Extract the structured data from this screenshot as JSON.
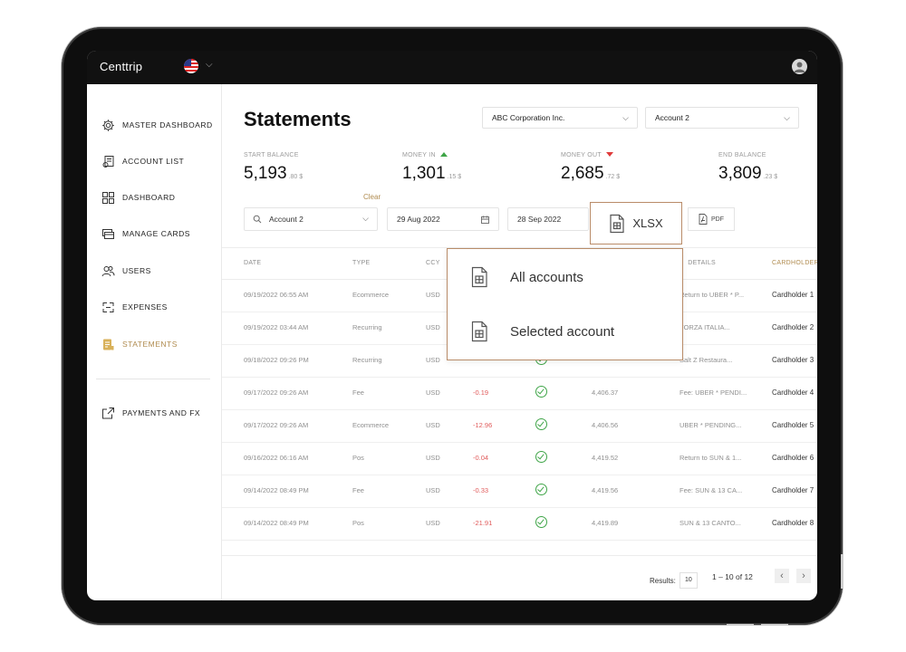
{
  "app": {
    "brand": "Centtrip"
  },
  "sidebar": {
    "items": [
      {
        "label": "MASTER DASHBOARD",
        "icon": "gear-icon"
      },
      {
        "label": "ACCOUNT LIST",
        "icon": "account-list-icon"
      },
      {
        "label": "DASHBOARD",
        "icon": "dashboard-grid-icon"
      },
      {
        "label": "MANAGE CARDS",
        "icon": "cards-icon"
      },
      {
        "label": "USERS",
        "icon": "users-icon"
      },
      {
        "label": "EXPENSES",
        "icon": "expenses-icon"
      },
      {
        "label": "STATEMENTS",
        "icon": "statements-icon",
        "active": true
      },
      {
        "label": "PAYMENTS AND FX",
        "icon": "external-link-icon"
      }
    ]
  },
  "page": {
    "title": "Statements",
    "company_select": "ABC Corporation Inc.",
    "account_select": "Account 2"
  },
  "balances": {
    "start": {
      "label": "START BALANCE",
      "value": "5,193",
      "decimals": ".80 $"
    },
    "money_in": {
      "label": "MONEY IN",
      "value": "1,301",
      "decimals": ".15 $"
    },
    "money_out": {
      "label": "MONEY OUT",
      "value": "2,685",
      "decimals": ".72 $"
    },
    "end": {
      "label": "END BALANCE",
      "value": "3,809",
      "decimals": ".23 $"
    }
  },
  "filters": {
    "clear": "Clear",
    "account": "Account 2",
    "date_from": "29 Aug 2022",
    "date_to": "28 Sep 2022",
    "xlsx": "XLSX",
    "pdf": "PDF"
  },
  "export_menu": {
    "items": [
      "All accounts",
      "Selected account"
    ]
  },
  "table": {
    "headers": {
      "date": "DATE",
      "type": "TYPE",
      "ccy": "CCY",
      "details": "DETAILS",
      "cardholder": "CARDHOLDER"
    },
    "rows": [
      {
        "date": "09/19/2022 06:55 AM",
        "type": "Ecommerce",
        "ccy": "USD",
        "amount": "",
        "balance": "",
        "details": "Return to UBER * P...",
        "cardholder": "Cardholder 1"
      },
      {
        "date": "09/19/2022 03:44 AM",
        "type": "Recurring",
        "ccy": "USD",
        "amount": "",
        "balance": "",
        "details": "FORZA ITALIA...",
        "cardholder": "Cardholder 2"
      },
      {
        "date": "09/18/2022 09:26 PM",
        "type": "Recurring",
        "ccy": "USD",
        "amount": "",
        "balance": "",
        "details": "Salt Z Restaura...",
        "cardholder": "Cardholder 3"
      },
      {
        "date": "09/17/2022 09:26 AM",
        "type": "Fee",
        "ccy": "USD",
        "amount": "-0.19",
        "balance": "4,406.37",
        "details": "Fee: UBER * PENDI...",
        "cardholder": "Cardholder 4"
      },
      {
        "date": "09/17/2022 09:26 AM",
        "type": "Ecommerce",
        "ccy": "USD",
        "amount": "-12.96",
        "balance": "4,406.56",
        "details": "UBER * PENDING...",
        "cardholder": "Cardholder 5"
      },
      {
        "date": "09/16/2022 06:16 AM",
        "type": "Pos",
        "ccy": "USD",
        "amount": "-0.04",
        "balance": "4,419.52",
        "details": "Return to SUN & 1...",
        "cardholder": "Cardholder 6"
      },
      {
        "date": "09/14/2022 08:49 PM",
        "type": "Fee",
        "ccy": "USD",
        "amount": "-0.33",
        "balance": "4,419.56",
        "details": "Fee: SUN & 13 CA...",
        "cardholder": "Cardholder 7"
      },
      {
        "date": "09/14/2022 08:49 PM",
        "type": "Pos",
        "ccy": "USD",
        "amount": "-21.91",
        "balance": "4,419.89",
        "details": "SUN & 13 CANTO...",
        "cardholder": "Cardholder 8"
      }
    ]
  },
  "pagination": {
    "results_label": "Results:",
    "page_size": "10",
    "range": "1 – 10 of 12"
  },
  "colors": {
    "accent": "#b08b4f",
    "positive": "#3fa548",
    "negative": "#e03b3b",
    "highlight_border": "#b98c69"
  }
}
